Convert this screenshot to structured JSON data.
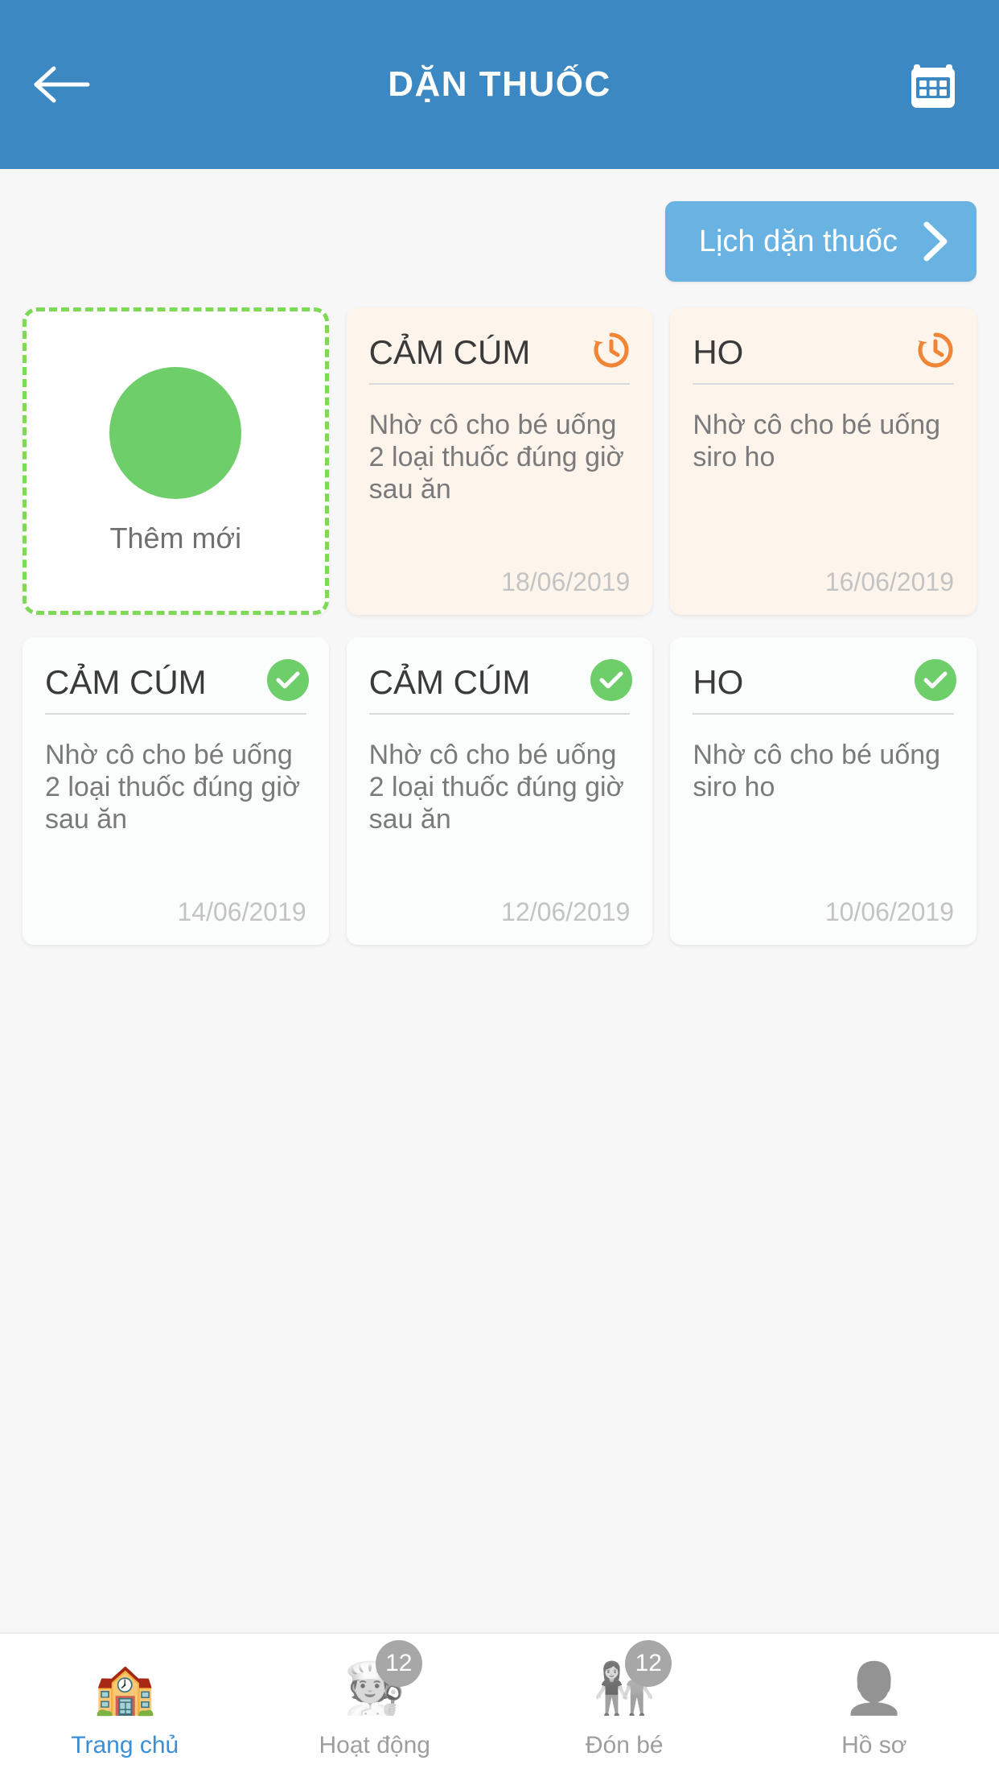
{
  "header": {
    "title": "DẶN THUỐC",
    "back_icon": "arrow-left-icon",
    "calendar_icon": "calendar-icon",
    "background_color": "#3b88c3"
  },
  "schedule_button": {
    "label": "Lịch dặn thuốc",
    "chevron_icon": "chevron-right-icon",
    "color": "#68b3e2"
  },
  "add_card": {
    "label": "Thêm mới",
    "plus_icon": "plus-icon",
    "border_color": "#7ed957",
    "circle_color": "#6ece6a"
  },
  "cards": [
    {
      "title": "CẢM CÚM",
      "body": "Nhờ cô cho bé uống 2 loại thuốc đúng giờ sau ăn",
      "date": "18/06/2019",
      "status": "pending",
      "status_icon": "history-icon",
      "status_color": "#ef8535",
      "background": "#fdf5ec"
    },
    {
      "title": "HO",
      "body": "Nhờ cô cho bé uống siro ho",
      "date": "16/06/2019",
      "status": "pending",
      "status_icon": "history-icon",
      "status_color": "#ef8535",
      "background": "#fdf5ec"
    },
    {
      "title": "CẢM CÚM",
      "body": "Nhờ cô cho bé uống 2 loại thuốc đúng giờ sau ăn",
      "date": "14/06/2019",
      "status": "done",
      "status_icon": "check-circle-icon",
      "status_color": "#6ece6a",
      "background": "#fbfdfd"
    },
    {
      "title": "CẢM CÚM",
      "body": "Nhờ cô cho bé uống 2 loại thuốc đúng giờ sau ăn",
      "date": "12/06/2019",
      "status": "done",
      "status_icon": "check-circle-icon",
      "status_color": "#6ece6a",
      "background": "#fbfdfd"
    },
    {
      "title": "HO",
      "body": "Nhờ cô cho bé uống siro ho",
      "date": "10/06/2019",
      "status": "done",
      "status_icon": "check-circle-icon",
      "status_color": "#6ece6a",
      "background": "#fbfdfd"
    }
  ],
  "tabbar": {
    "items": [
      {
        "label": "Trang chủ",
        "icon": "school-building-icon",
        "glyph": "🏫",
        "badge": "",
        "active": true
      },
      {
        "label": "Hoạt động",
        "icon": "activity-person-icon",
        "glyph": "🧑‍🍳",
        "badge": "12",
        "active": false
      },
      {
        "label": "Đón bé",
        "icon": "pickup-child-icon",
        "glyph": "👫",
        "badge": "12",
        "active": false
      },
      {
        "label": "Hồ sơ",
        "icon": "profile-person-icon",
        "glyph": "👤",
        "badge": "",
        "active": false
      }
    ],
    "active_color": "#3b8fd4",
    "badge_color": "#ed6a5e"
  }
}
